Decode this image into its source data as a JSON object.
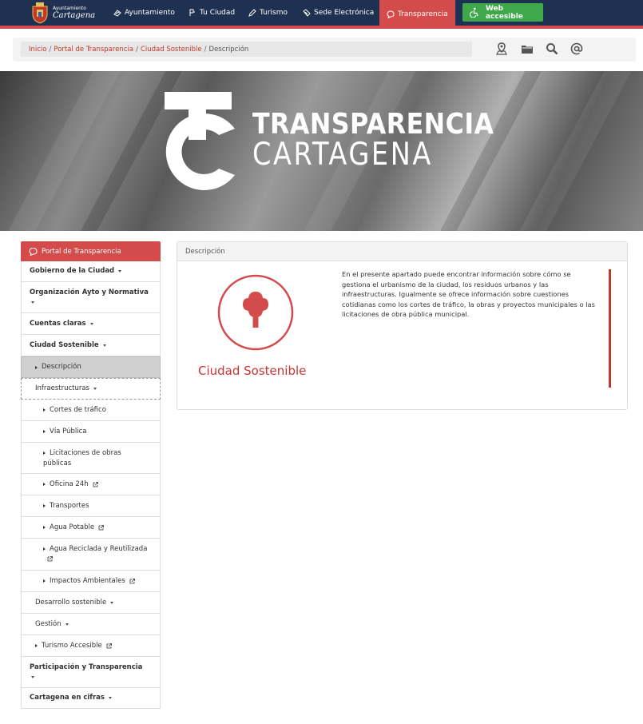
{
  "nav": {
    "logo_line1": "Ayuntamiento",
    "logo_line2": "Cartagena",
    "items": [
      {
        "label": "Ayuntamiento",
        "icon": "ayuntamiento-icon"
      },
      {
        "label": "Tu Ciudad",
        "icon": "ciudad-icon"
      },
      {
        "label": "Turismo",
        "icon": "turismo-icon"
      },
      {
        "label": "Sede Electrónica",
        "icon": "sede-icon"
      },
      {
        "label": "Transparencia",
        "icon": "chat-icon",
        "active": true
      }
    ],
    "accesible_label": "Web accesible",
    "accent": "#d34b4b",
    "bg": "#1e3150",
    "accesible_color": "#3ea84a"
  },
  "breadcrumb": {
    "items": [
      "Inicio",
      "Portal de Transparencia",
      "Ciudad Sostenible"
    ],
    "current": "Descripción"
  },
  "toolbar": {
    "icons": [
      "map-pin-icon",
      "folder-icon",
      "search-icon",
      "at-icon"
    ]
  },
  "banner": {
    "title_line1": "TRANSPARENCIA",
    "title_line2": "CARTAGENA"
  },
  "sidebar": {
    "header": "Portal de Transparencia",
    "items": [
      {
        "label": "Gobierno de la Ciudad"
      },
      {
        "label": "Organización Ayto y Normativa"
      },
      {
        "label": "Cuentas claras"
      },
      {
        "label": "Ciudad Sostenible"
      },
      {
        "label": "Descripción"
      },
      {
        "label": "Infraestructuras"
      },
      {
        "label": "Cortes de tráfico"
      },
      {
        "label": "Vía Pública"
      },
      {
        "label": "Licitaciones de obras públicas"
      },
      {
        "label": "Oficina 24h"
      },
      {
        "label": "Transportes"
      },
      {
        "label": "Agua Potable"
      },
      {
        "label": "Agua Reciclada y Reutilizada"
      },
      {
        "label": "Impactos Ambientales"
      },
      {
        "label": "Desarrollo sostenible"
      },
      {
        "label": "Gestión"
      },
      {
        "label": "Turismo Accesible"
      },
      {
        "label": "Participación y Transparencia"
      },
      {
        "label": "Cartagena en cifras"
      }
    ]
  },
  "main": {
    "title": "Descripción",
    "image_label": "Ciudad Sostenible",
    "description": "En el presente apartado puede encontrar información sobre cómo se gestiona el urbanismo de la ciudad, los residuos urbanos y las infraestructuras. Igualmente se ofrece información sobre cuestiones cotidianas como los cortes de tráfico, la obras y proyectos municipales o las licitaciones de obra pública municipal."
  }
}
